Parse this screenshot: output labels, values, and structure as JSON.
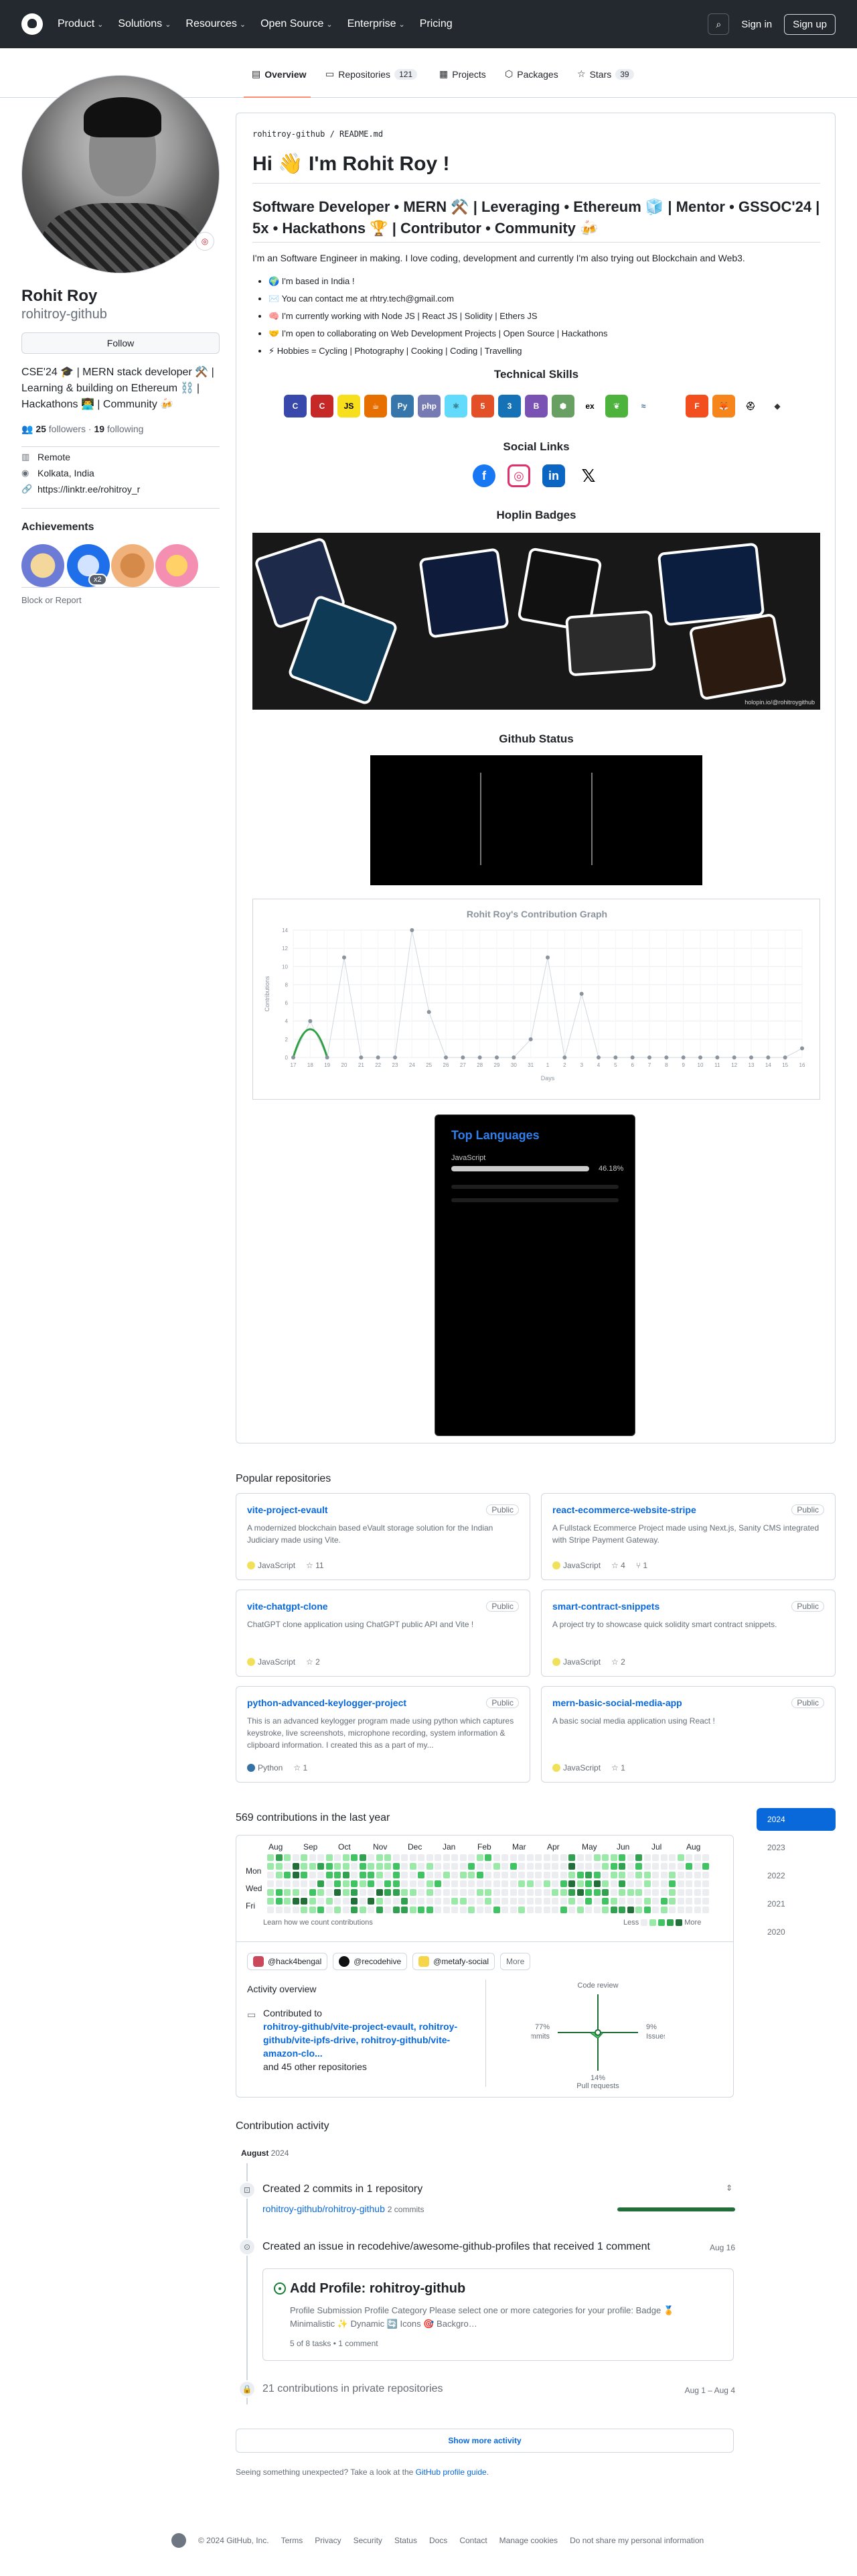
{
  "header": {
    "nav": [
      "Product",
      "Solutions",
      "Resources",
      "Open Source",
      "Enterprise",
      "Pricing"
    ],
    "signin": "Sign in",
    "signup": "Sign up"
  },
  "tabs": [
    {
      "label": "Overview"
    },
    {
      "label": "Repositories",
      "count": "121"
    },
    {
      "label": "Projects"
    },
    {
      "label": "Packages"
    },
    {
      "label": "Stars",
      "count": "39"
    }
  ],
  "profile": {
    "name": "Rohit Roy",
    "login": "rohitroy-github",
    "follow": "Follow",
    "bio": "CSE'24 🎓 | MERN stack developer ⚒️ | Learning & building on Ethereum ⛓️ | Hackathons 👨‍💻 | Community 🍻",
    "followers": "25",
    "followers_label": "followers",
    "following": "19",
    "following_label": "following",
    "location_work": "Remote",
    "location": "Kolkata, India",
    "link": "https://linktr.ee/rohitroy_r",
    "achievements_title": "Achievements",
    "achievement_x2": "x2",
    "block": "Block or Report"
  },
  "readme": {
    "path": "rohitroy-github / README.md",
    "h1": "Hi 👋 I'm Rohit Roy !",
    "h2": "Software Developer • MERN ⚒️ | Leveraging • Ethereum 🧊 | Mentor • GSSOC'24 | 5x • Hackathons 🏆 | Contributor • Community 🍻",
    "intro": "I'm an Software Engineer in making. I love coding, development and currently I'm also trying out Blockchain and Web3.",
    "bullets": [
      "🌍 I'm based in India !",
      "✉️ You can contact me at rhtry.tech@gmail.com",
      "🧠 I'm currently working with Node JS | React JS | Solidity | Ethers JS",
      "🤝 I'm open to collaborating on Web Development Projects | Open Source | Hackathons",
      "⚡ Hobbies = Cycling | Photography | Cooking | Coding | Travelling"
    ],
    "email": "rhtry.tech@gmail.com",
    "skills_title": "Technical Skills",
    "socials_title": "Social Links",
    "badges_title": "Hoplin Badges",
    "badge_caption": "holopin.io/@rohitroygithub",
    "status_title": "Github Status",
    "graph_title": "Rohit Roy's Contribution Graph",
    "graph_ylabel": "Contributions",
    "graph_xlabel": "Days",
    "langs_title": "Top Languages",
    "langs_js": "JavaScript",
    "langs_pct": "46.18%"
  },
  "chart_data": {
    "type": "line",
    "title": "Rohit Roy's Contribution Graph",
    "xlabel": "Days",
    "ylabel": "Contributions",
    "ylim": [
      0,
      14
    ],
    "x": [
      "17",
      "18",
      "19",
      "20",
      "21",
      "22",
      "23",
      "24",
      "25",
      "26",
      "27",
      "28",
      "29",
      "30",
      "31",
      "1",
      "2",
      "3",
      "4",
      "5",
      "6",
      "7",
      "8",
      "9",
      "10",
      "11",
      "12",
      "13",
      "14",
      "15",
      "16"
    ],
    "series": [
      {
        "values": [
          0,
          4,
          0,
          11,
          0,
          0,
          0,
          14,
          5,
          0,
          0,
          0,
          0,
          0,
          2,
          11,
          0,
          7,
          0,
          0,
          0,
          0,
          0,
          0,
          0,
          0,
          0,
          0,
          0,
          0,
          1
        ]
      }
    ]
  },
  "popular": {
    "title": "Popular repositories",
    "repos": [
      {
        "name": "vite-project-evault",
        "vis": "Public",
        "desc": "A modernized blockchain based eVault storage solution for the Indian Judiciary made using Vite.",
        "lang": "JavaScript",
        "stars": "11",
        "forks": ""
      },
      {
        "name": "react-ecommerce-website-stripe",
        "vis": "Public",
        "desc": "A Fullstack Ecommerce Project made using Next.js, Sanity CMS integrated with Stripe Payment Gateway.",
        "lang": "JavaScript",
        "stars": "4",
        "forks": "1"
      },
      {
        "name": "vite-chatgpt-clone",
        "vis": "Public",
        "desc": "ChatGPT clone application using ChatGPT public API and Vite !",
        "lang": "JavaScript",
        "stars": "2",
        "forks": ""
      },
      {
        "name": "smart-contract-snippets",
        "vis": "Public",
        "desc": "A project try to showcase quick solidity smart contract snippets.",
        "lang": "JavaScript",
        "stars": "2",
        "forks": ""
      },
      {
        "name": "python-advanced-keylogger-project",
        "vis": "Public",
        "desc": "This is an advanced keylogger program made using python which captures keystroke, live screenshots, microphone recording, system information & clipboard information. I created this as a part of my...",
        "lang": "Python",
        "stars": "1",
        "forks": ""
      },
      {
        "name": "mern-basic-social-media-app",
        "vis": "Public",
        "desc": "A basic social media application using React !",
        "lang": "JavaScript",
        "stars": "1",
        "forks": ""
      }
    ]
  },
  "contrib": {
    "title": "569 contributions in the last year",
    "months": [
      "Aug",
      "Sep",
      "Oct",
      "Nov",
      "Dec",
      "Jan",
      "Feb",
      "Mar",
      "Apr",
      "May",
      "Jun",
      "Jul",
      "Aug"
    ],
    "days": [
      "Mon",
      "Wed",
      "Fri"
    ],
    "learn": "Learn how we count contributions",
    "less": "Less",
    "more": "More",
    "years": [
      "2024",
      "2023",
      "2022",
      "2021",
      "2020"
    ],
    "orgs": [
      "@hack4bengal",
      "@recodehive",
      "@metafy-social"
    ],
    "orgs_more": "More",
    "activity_title": "Activity overview",
    "contributed_to": "Contributed to",
    "contrib_repos": "rohitroy-github/vite-project-evault, rohitroy-github/vite-ipfs-drive, rohitroy-github/vite-amazon-clo...",
    "contrib_other": "and 45 other repositories",
    "code_review": "Code review",
    "commits_pct": "77%",
    "commits": "Commits",
    "issues_pct": "9%",
    "issues": "Issues",
    "prs_pct": "14%",
    "prs": "Pull requests"
  },
  "activity": {
    "title": "Contribution activity",
    "month": "August",
    "year": "2024",
    "item1_title": "Created 2 commits in 1 repository",
    "item1_repo": "rohitroy-github/rohitroy-github",
    "item1_count": "2 commits",
    "item2_title": "Created an issue in recodehive/awesome-github-profiles that received 1 comment",
    "item2_date": "Aug 16",
    "issue_title": "Add Profile: rohitroy-github",
    "issue_body": "Profile Submission Profile Category Please select one or more categories for your profile: Badge 🏅 Minimalistic ✨ Dynamic 🔄 Icons 🎯 Backgro…",
    "issue_meta": "5 of 8 tasks  • 1 comment",
    "item3_title": "21 contributions in private repositories",
    "item3_date": "Aug 1 – Aug 4",
    "show_more": "Show more activity",
    "guide_text": "Seeing something unexpected? Take a look at the",
    "guide_link": "GitHub profile guide"
  },
  "footer": {
    "copy": "© 2024 GitHub, Inc.",
    "links": [
      "Terms",
      "Privacy",
      "Security",
      "Status",
      "Docs",
      "Contact",
      "Manage cookies",
      "Do not share my personal information"
    ]
  }
}
